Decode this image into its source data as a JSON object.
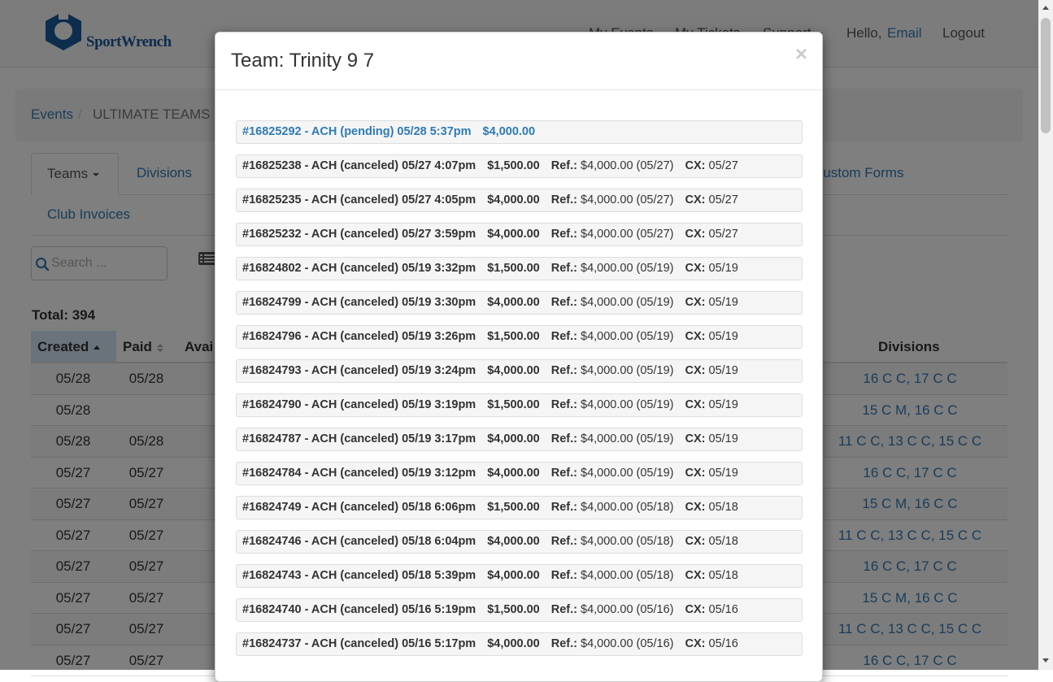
{
  "nav": {
    "logo_text": "SportWrench",
    "my_events": "My Events",
    "my_tickets": "My Tickets",
    "support": "Support",
    "hello": "Hello,",
    "user": "Email",
    "logout": "Logout"
  },
  "breadcrumb": {
    "events": "Events",
    "sep": "/",
    "current": "ULTIMATE TEAMS"
  },
  "tabs": {
    "teams": "Teams",
    "divisions": "Divisions",
    "custom_forms": "Custom Forms",
    "club_invoices": "Club Invoices"
  },
  "search": {
    "placeholder": "Search ..."
  },
  "total": "Total: 394",
  "table": {
    "headers": {
      "created": "Created",
      "paid": "Paid",
      "available": "Avai",
      "divisions": "Divisions"
    },
    "rows": [
      {
        "created": "05/28",
        "paid": "05/28",
        "divisions": "16 C C, 17 C C"
      },
      {
        "created": "05/28",
        "paid": "",
        "divisions": "15 C M, 16 C C"
      },
      {
        "created": "05/28",
        "paid": "05/28",
        "divisions": "11 C C, 13 C C, 15 C C"
      },
      {
        "created": "05/27",
        "paid": "05/27",
        "divisions": "16 C C, 17 C C"
      },
      {
        "created": "05/27",
        "paid": "05/27",
        "divisions": "15 C M, 16 C C"
      },
      {
        "created": "05/27",
        "paid": "05/27",
        "divisions": "11 C C, 13 C C, 15 C C"
      },
      {
        "created": "05/27",
        "paid": "05/27",
        "divisions": "16 C C, 17 C C"
      },
      {
        "created": "05/27",
        "paid": "05/27",
        "divisions": "15 C M, 16 C C"
      },
      {
        "created": "05/27",
        "paid": "05/27",
        "divisions": "11 C C, 13 C C, 15 C C"
      },
      {
        "created": "05/27",
        "paid": "05/27",
        "divisions": "16 C C, 17 C C"
      }
    ]
  },
  "modal": {
    "title": "Team: Trinity 9 7",
    "close": "×",
    "payments": [
      {
        "desc": "#16825292 - ACH (pending) 05/28 5:37pm",
        "amount": "$4,000.00",
        "pending": true
      },
      {
        "desc": "#16825238 - ACH (canceled) 05/27 4:07pm",
        "amount": "$1,500.00",
        "ref_label": "Ref.:",
        "ref": "$4,000.00 (05/27)",
        "cx_label": "CX:",
        "cx": "05/27"
      },
      {
        "desc": "#16825235 - ACH (canceled) 05/27 4:05pm",
        "amount": "$4,000.00",
        "ref_label": "Ref.:",
        "ref": "$4,000.00 (05/27)",
        "cx_label": "CX:",
        "cx": "05/27"
      },
      {
        "desc": "#16825232 - ACH (canceled) 05/27 3:59pm",
        "amount": "$4,000.00",
        "ref_label": "Ref.:",
        "ref": "$4,000.00 (05/27)",
        "cx_label": "CX:",
        "cx": "05/27"
      },
      {
        "desc": "#16824802 - ACH (canceled) 05/19 3:32pm",
        "amount": "$1,500.00",
        "ref_label": "Ref.:",
        "ref": "$4,000.00 (05/19)",
        "cx_label": "CX:",
        "cx": "05/19"
      },
      {
        "desc": "#16824799 - ACH (canceled) 05/19 3:30pm",
        "amount": "$4,000.00",
        "ref_label": "Ref.:",
        "ref": "$4,000.00 (05/19)",
        "cx_label": "CX:",
        "cx": "05/19"
      },
      {
        "desc": "#16824796 - ACH (canceled) 05/19 3:26pm",
        "amount": "$1,500.00",
        "ref_label": "Ref.:",
        "ref": "$4,000.00 (05/19)",
        "cx_label": "CX:",
        "cx": "05/19"
      },
      {
        "desc": "#16824793 - ACH (canceled) 05/19 3:24pm",
        "amount": "$4,000.00",
        "ref_label": "Ref.:",
        "ref": "$4,000.00 (05/19)",
        "cx_label": "CX:",
        "cx": "05/19"
      },
      {
        "desc": "#16824790 - ACH (canceled) 05/19 3:19pm",
        "amount": "$1,500.00",
        "ref_label": "Ref.:",
        "ref": "$4,000.00 (05/19)",
        "cx_label": "CX:",
        "cx": "05/19"
      },
      {
        "desc": "#16824787 - ACH (canceled) 05/19 3:17pm",
        "amount": "$4,000.00",
        "ref_label": "Ref.:",
        "ref": "$4,000.00 (05/19)",
        "cx_label": "CX:",
        "cx": "05/19"
      },
      {
        "desc": "#16824784 - ACH (canceled) 05/19 3:12pm",
        "amount": "$4,000.00",
        "ref_label": "Ref.:",
        "ref": "$4,000.00 (05/19)",
        "cx_label": "CX:",
        "cx": "05/19"
      },
      {
        "desc": "#16824749 - ACH (canceled) 05/18 6:06pm",
        "amount": "$1,500.00",
        "ref_label": "Ref.:",
        "ref": "$4,000.00 (05/18)",
        "cx_label": "CX:",
        "cx": "05/18"
      },
      {
        "desc": "#16824746 - ACH (canceled) 05/18 6:04pm",
        "amount": "$4,000.00",
        "ref_label": "Ref.:",
        "ref": "$4,000.00 (05/18)",
        "cx_label": "CX:",
        "cx": "05/18"
      },
      {
        "desc": "#16824743 - ACH (canceled) 05/18 5:39pm",
        "amount": "$4,000.00",
        "ref_label": "Ref.:",
        "ref": "$4,000.00 (05/18)",
        "cx_label": "CX:",
        "cx": "05/18"
      },
      {
        "desc": "#16824740 - ACH (canceled) 05/16 5:19pm",
        "amount": "$1,500.00",
        "ref_label": "Ref.:",
        "ref": "$4,000.00 (05/16)",
        "cx_label": "CX:",
        "cx": "05/16"
      },
      {
        "desc": "#16824737 - ACH (canceled) 05/16 5:17pm",
        "amount": "$4,000.00",
        "ref_label": "Ref.:",
        "ref": "$4,000.00 (05/16)",
        "cx_label": "CX:",
        "cx": "05/16"
      }
    ]
  },
  "colors": {
    "link": "#337ab7",
    "pending": "#2e7bb5",
    "sorted_header": "#d5e7f7",
    "logo": "#1a5a9a"
  }
}
